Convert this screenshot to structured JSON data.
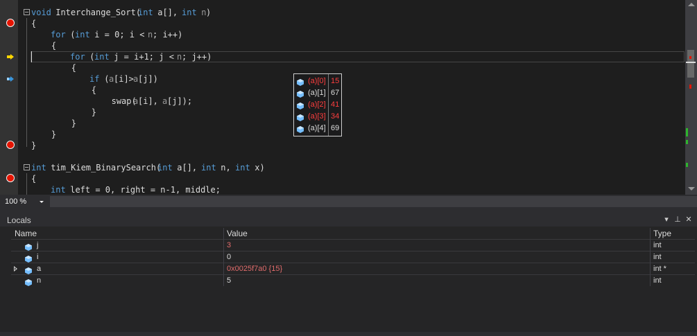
{
  "editor": {
    "lines": [
      {
        "t": [
          {
            "c": "kw",
            "s": "void"
          },
          {
            "c": "pl",
            "s": " Interchange_Sort("
          },
          {
            "c": "kw",
            "s": "int"
          },
          {
            "c": "pl",
            "s": " a[], "
          },
          {
            "c": "kw",
            "s": "int"
          },
          {
            "c": "pr",
            "s": " n"
          },
          {
            "c": "pl",
            "s": ")"
          }
        ]
      },
      {
        "t": [
          {
            "c": "pl",
            "s": "{"
          }
        ]
      },
      {
        "t": [
          {
            "c": "pl",
            "s": "    "
          },
          {
            "c": "kw",
            "s": "for"
          },
          {
            "c": "pl",
            "s": " ("
          },
          {
            "c": "kw",
            "s": "int"
          },
          {
            "c": "pl",
            "s": " i = 0; i < "
          },
          {
            "c": "pr",
            "s": "n"
          },
          {
            "c": "pl",
            "s": "; i++)"
          }
        ]
      },
      {
        "t": [
          {
            "c": "pl",
            "s": "    {"
          }
        ]
      },
      {
        "t": [
          {
            "c": "pl",
            "s": "        "
          },
          {
            "c": "kw",
            "s": "for"
          },
          {
            "c": "pl",
            "s": " ("
          },
          {
            "c": "kw",
            "s": "int"
          },
          {
            "c": "pl",
            "s": " j = i+1; j < "
          },
          {
            "c": "pr",
            "s": "n"
          },
          {
            "c": "pl",
            "s": "; j++)"
          }
        ]
      },
      {
        "t": [
          {
            "c": "pl",
            "s": "        {"
          }
        ]
      },
      {
        "t": [
          {
            "c": "pl",
            "s": "            "
          },
          {
            "c": "kw",
            "s": "if"
          },
          {
            "c": "pl",
            "s": " ("
          },
          {
            "c": "pr",
            "s": "a"
          },
          {
            "c": "pl",
            "s": "[i]>"
          },
          {
            "c": "pr",
            "s": "a"
          },
          {
            "c": "pl",
            "s": "[j])"
          }
        ]
      },
      {
        "t": [
          {
            "c": "pl",
            "s": "            {"
          }
        ]
      },
      {
        "t": [
          {
            "c": "pl",
            "s": "                swap("
          },
          {
            "c": "pr",
            "s": "a"
          },
          {
            "c": "pl",
            "s": "[i], "
          },
          {
            "c": "pr",
            "s": "a"
          },
          {
            "c": "pl",
            "s": "[j]);"
          }
        ]
      },
      {
        "t": [
          {
            "c": "pl",
            "s": "            }"
          }
        ]
      },
      {
        "t": [
          {
            "c": "pl",
            "s": "        }"
          }
        ]
      },
      {
        "t": [
          {
            "c": "pl",
            "s": "    }"
          }
        ]
      },
      {
        "t": [
          {
            "c": "pl",
            "s": "}"
          }
        ]
      },
      {
        "t": []
      },
      {
        "t": [
          {
            "c": "kw",
            "s": "int"
          },
          {
            "c": "pl",
            "s": " tim_Kiem_BinarySearch("
          },
          {
            "c": "kw",
            "s": "int"
          },
          {
            "c": "pl",
            "s": " a[], "
          },
          {
            "c": "kw",
            "s": "int"
          },
          {
            "c": "pl",
            "s": " n, "
          },
          {
            "c": "kw",
            "s": "int"
          },
          {
            "c": "pl",
            "s": " x)"
          }
        ]
      },
      {
        "t": [
          {
            "c": "pl",
            "s": "{"
          }
        ]
      },
      {
        "t": [
          {
            "c": "pl",
            "s": "    "
          },
          {
            "c": "kw",
            "s": "int"
          },
          {
            "c": "pl",
            "s": " left = 0, right = n-1, middle;"
          }
        ]
      }
    ]
  },
  "datatip": {
    "rows": [
      {
        "name": "(a)[0]",
        "value": "15",
        "changed": true
      },
      {
        "name": "(a)[1]",
        "value": "67",
        "changed": false
      },
      {
        "name": "(a)[2]",
        "value": "41",
        "changed": true
      },
      {
        "name": "(a)[3]",
        "value": "34",
        "changed": true
      },
      {
        "name": "(a)[4]",
        "value": "69",
        "changed": false
      }
    ]
  },
  "zoom": {
    "value": "100 %"
  },
  "locals": {
    "title": "Locals",
    "columns": {
      "name": "Name",
      "value": "Value",
      "type": "Type"
    },
    "rows": [
      {
        "name": "j",
        "value": "3",
        "type": "int",
        "expandable": false,
        "changed": true
      },
      {
        "name": "i",
        "value": "0",
        "type": "int",
        "expandable": false,
        "changed": false
      },
      {
        "name": "a",
        "value": "0x0025f7a0 {15}",
        "type": "int *",
        "expandable": true,
        "changed": true
      },
      {
        "name": "n",
        "value": "5",
        "type": "int",
        "expandable": false,
        "changed": false
      }
    ]
  },
  "colors": {
    "keyword": "#569cd6",
    "breakpoint": "#e51400",
    "changed": "#ff3e3e",
    "background": "#1e1e1e"
  }
}
